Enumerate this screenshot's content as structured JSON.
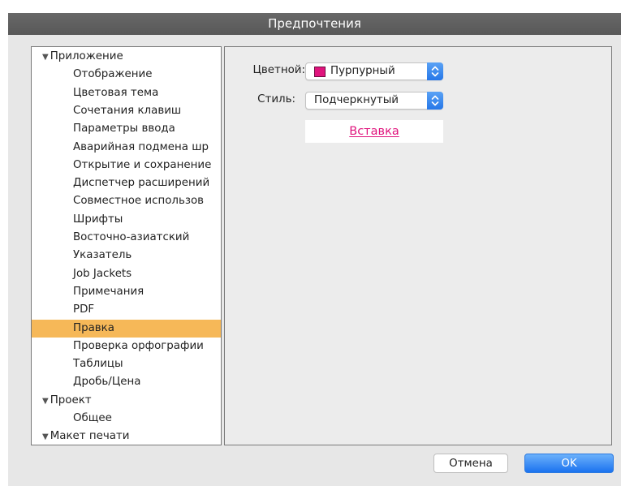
{
  "window": {
    "title": "Предпочтения"
  },
  "tree": {
    "items": [
      {
        "label": "Приложение",
        "kind": "group",
        "expanded": true
      },
      {
        "label": "Отображение",
        "kind": "child"
      },
      {
        "label": "Цветовая тема",
        "kind": "child"
      },
      {
        "label": "Сочетания клавиш",
        "kind": "child"
      },
      {
        "label": "Параметры ввода",
        "kind": "child"
      },
      {
        "label": "Аварийная подмена шр",
        "kind": "child"
      },
      {
        "label": "Открытие и сохранение",
        "kind": "child"
      },
      {
        "label": "Диспетчер расширений",
        "kind": "child"
      },
      {
        "label": "Совместное использов",
        "kind": "child"
      },
      {
        "label": "Шрифты",
        "kind": "child"
      },
      {
        "label": "Восточно-азиатский",
        "kind": "child"
      },
      {
        "label": "Указатель",
        "kind": "child"
      },
      {
        "label": "Job Jackets",
        "kind": "child"
      },
      {
        "label": "Примечания",
        "kind": "child"
      },
      {
        "label": "PDF",
        "kind": "child"
      },
      {
        "label": "Правка",
        "kind": "child",
        "selected": true
      },
      {
        "label": "Проверка орфографии",
        "kind": "child"
      },
      {
        "label": "Таблицы",
        "kind": "child"
      },
      {
        "label": "Дробь/Цена",
        "kind": "child"
      },
      {
        "label": "Проект",
        "kind": "group",
        "expanded": true
      },
      {
        "label": "Общее",
        "kind": "child"
      },
      {
        "label": "Макет печати",
        "kind": "group",
        "expanded": true
      }
    ],
    "selection_color": "#f6b858"
  },
  "settings": {
    "color_label": "Цветной:",
    "color_value": "Пурпурный",
    "color_swatch": "#e0147d",
    "style_label": "Стиль:",
    "style_value": "Подчеркнутый",
    "preview_text": "Вставка",
    "preview_color": "#e0147d"
  },
  "buttons": {
    "cancel": "Отмена",
    "ok": "OK"
  },
  "icons": {
    "expanded": "disclosure-triangle-down-icon",
    "stepper": "up-down-stepper-icon"
  }
}
